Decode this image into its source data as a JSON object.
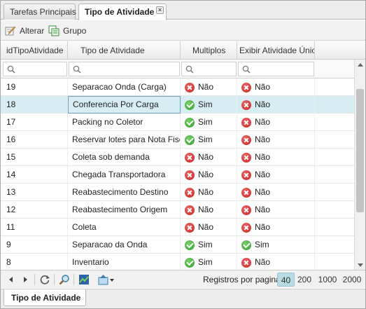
{
  "tabs": [
    {
      "label": "Tarefas Principais"
    },
    {
      "label": "Tipo de Atividade"
    }
  ],
  "toolbar": {
    "edit_label": "Alterar",
    "group_label": "Grupo"
  },
  "grid": {
    "columns": [
      "idTipoAtividade",
      "Tipo de Atividade",
      "Multiplos",
      "Exibir Atividade Única"
    ],
    "rows": [
      {
        "id": "19",
        "tipo": "Separacao Onda (Carga)",
        "multiplos": "Não",
        "exibir": "Não"
      },
      {
        "id": "18",
        "tipo": "Conferencia Por Carga",
        "multiplos": "Sim",
        "exibir": "Não"
      },
      {
        "id": "17",
        "tipo": "Packing no Coletor",
        "multiplos": "Sim",
        "exibir": "Não"
      },
      {
        "id": "16",
        "tipo": "Reservar lotes para Nota Fiscal",
        "multiplos": "Sim",
        "exibir": "Não"
      },
      {
        "id": "15",
        "tipo": "Coleta sob demanda",
        "multiplos": "Não",
        "exibir": "Não"
      },
      {
        "id": "14",
        "tipo": "Chegada Transportadora",
        "multiplos": "Não",
        "exibir": "Não"
      },
      {
        "id": "13",
        "tipo": "Reabastecimento Destino",
        "multiplos": "Não",
        "exibir": "Não"
      },
      {
        "id": "12",
        "tipo": "Reabastecimento Origem",
        "multiplos": "Não",
        "exibir": "Não"
      },
      {
        "id": "11",
        "tipo": "Coleta",
        "multiplos": "Não",
        "exibir": "Não"
      },
      {
        "id": "9",
        "tipo": "Separacao da Onda",
        "multiplos": "Sim",
        "exibir": "Sim"
      },
      {
        "id": "8",
        "tipo": "Inventario",
        "multiplos": "Sim",
        "exibir": "Não"
      }
    ]
  },
  "pager": {
    "page_size_label": "Registros por pagina:",
    "sizes": [
      "40",
      "200",
      "1000",
      "2000"
    ],
    "active_size": "40"
  },
  "bottom_tab": {
    "label": "Tipo de Atividade"
  },
  "colors": {
    "selected_row": "#d6eef3",
    "no_icon": "#c91f1f",
    "yes_icon": "#2f9a2a"
  }
}
